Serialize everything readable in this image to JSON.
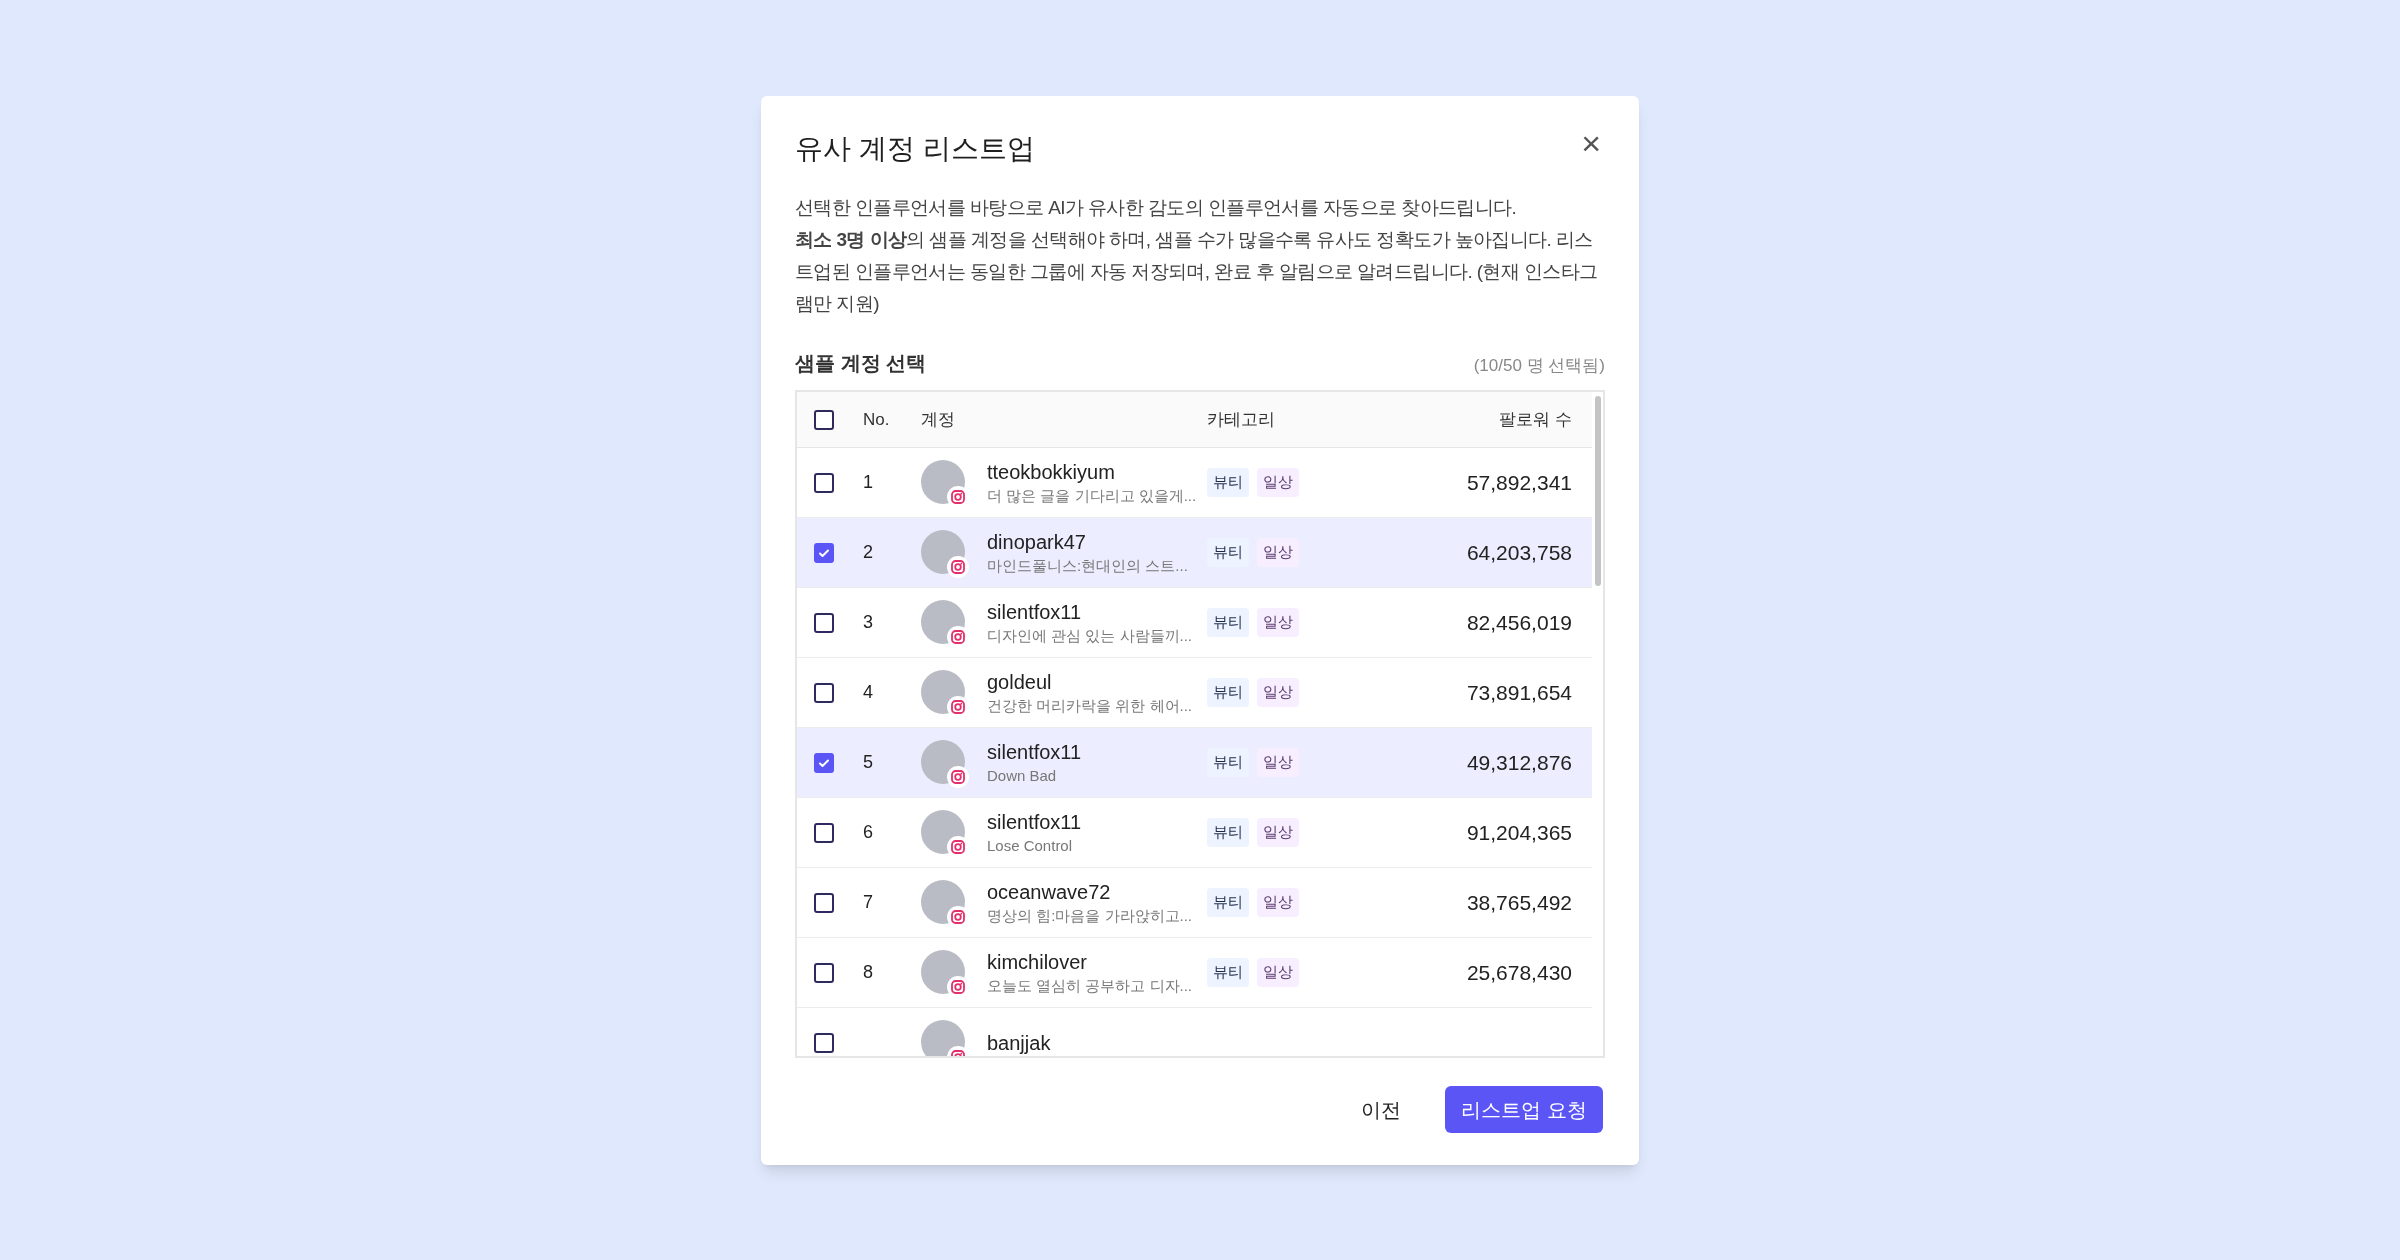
{
  "dialog": {
    "title": "유사 계정 리스트업",
    "close": "×",
    "description": [
      "선택한 인플루언서를 바탕으로 AI가 유사한 감도의 인플루언서를 자동으로 찾아드립니다.",
      "**최소 3명 이상**의 샘플 계정을 선택해야 하며, 샘플 수가 많을수록 유사도 정확도가 높아집니다. 리스트업된 인플루언서는 동일한 그룹에 자동 저장되며, 완료 후 알림으로 알려드립니다. (현재 인스타그램만 지원)"
    ],
    "section_title": "샘플 계정 선택",
    "selection_count": "(10/50 명 선택됨)"
  },
  "table": {
    "columns": [
      "No.",
      "계정",
      "카테고리",
      "팔로워 수"
    ],
    "select_all": {
      "checked": false
    },
    "rows": [
      {
        "no": "1",
        "username": "tteokbokkiyum",
        "bio": "더 많은 글을 기다리고 있을게...",
        "tags": [
          "뷰티",
          "일상"
        ],
        "followers": "57,892,341",
        "selected": false
      },
      {
        "no": "2",
        "username": "dinopark47",
        "bio": "마인드풀니스:현대인의 스트...",
        "tags": [
          "뷰티",
          "일상"
        ],
        "followers": "64,203,758",
        "selected": true
      },
      {
        "no": "3",
        "username": "silentfox11",
        "bio": "디자인에 관심 있는 사람들끼...",
        "tags": [
          "뷰티",
          "일상"
        ],
        "followers": "82,456,019",
        "selected": false
      },
      {
        "no": "4",
        "username": "goldeul",
        "bio": "건강한 머리카락을 위한 헤어...",
        "tags": [
          "뷰티",
          "일상"
        ],
        "followers": "73,891,654",
        "selected": false
      },
      {
        "no": "5",
        "username": "silentfox11",
        "bio": "Down Bad",
        "tags": [
          "뷰티",
          "일상"
        ],
        "followers": "49,312,876",
        "selected": true
      },
      {
        "no": "6",
        "username": "silentfox11",
        "bio": "Lose Control",
        "tags": [
          "뷰티",
          "일상"
        ],
        "followers": "91,204,365",
        "selected": false
      },
      {
        "no": "7",
        "username": "oceanwave72",
        "bio": "명상의 힘:마음을 가라앉히고...",
        "tags": [
          "뷰티",
          "일상"
        ],
        "followers": "38,765,492",
        "selected": false
      },
      {
        "no": "8",
        "username": "kimchilover",
        "bio": "오늘도 열심히 공부하고 디자...",
        "tags": [
          "뷰티",
          "일상"
        ],
        "followers": "25,678,430",
        "selected": false
      },
      {
        "username": "banjjak",
        "selected": false
      }
    ]
  },
  "buttons": {
    "back": "이전",
    "submit": "리스트업 요청"
  }
}
